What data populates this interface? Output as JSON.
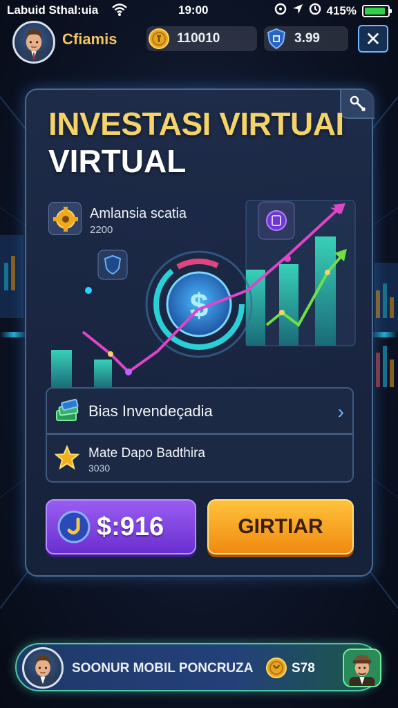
{
  "status_bar": {
    "carrier": "Labuid Sthal:uia",
    "time": "19:00",
    "battery": "415%",
    "battery_level": 0.9
  },
  "header": {
    "player_name": "Cfiamis",
    "coins": "110010",
    "gems": "3.99",
    "close_label": "✕"
  },
  "panel": {
    "title_line1": "INVESTASI VIRTUAI",
    "title_line2": "VIRTUAL",
    "stat": {
      "label": "Amlansia scatia",
      "value": "2200"
    },
    "rows": [
      {
        "label": "Bias Invendeçadia",
        "chevron": "›"
      },
      {
        "label": "Mate Dapo Badthira",
        "sub": "3030"
      }
    ],
    "price_label": "$:916",
    "buy_label": "GIRTIAR"
  },
  "bottom_bar": {
    "title": "SOONUR MOBIL PONCRUZA",
    "value": "S78"
  },
  "colors": {
    "title_gold": "#f3d36a",
    "accent_blue": "#6fb6ff",
    "buy_orange": "#f08a12",
    "price_purple": "#7a3fe0",
    "line_pink": "#e045c8",
    "line_green": "#6ee045",
    "bar_teal": "#2fb8a8"
  },
  "icons": {
    "wifi": "wifi-icon",
    "coin": "coin-icon",
    "gem": "shield-gem-icon",
    "settings": "settings-icon",
    "stat": "gear-icon",
    "row1": "cash-stack-icon",
    "row2": "star-icon",
    "price": "currency-icon"
  }
}
